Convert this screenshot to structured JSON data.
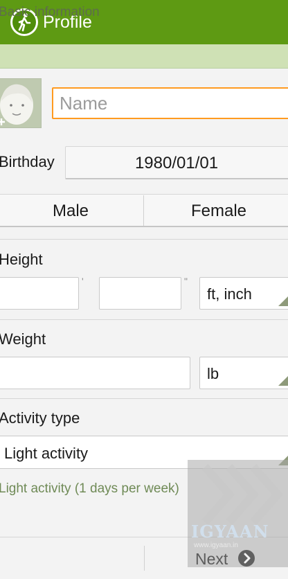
{
  "app": {
    "title": "Profile",
    "icon": "walking-person-icon",
    "accent": "#5e9a13"
  },
  "section": {
    "header": "Basic information"
  },
  "profile": {
    "avatar": "avatar-placeholder",
    "name_placeholder": "Name"
  },
  "birthday": {
    "label": "Birthday",
    "value": "1980/01/01"
  },
  "gender": {
    "options": [
      "Male",
      "Female"
    ]
  },
  "height": {
    "label": "Height",
    "ft_mark": "'",
    "in_mark": "\"",
    "unit": "ft, inch"
  },
  "weight": {
    "label": "Weight",
    "unit": "lb"
  },
  "activity": {
    "label": "Activity type",
    "value": "Light activity",
    "description": "Light activity (1 days per week)"
  },
  "footer": {
    "next_label": "Next",
    "next_icon": "chevron-right-icon"
  },
  "watermark": {
    "text": "IGYAAN",
    "url": "www.igyaan.in"
  }
}
